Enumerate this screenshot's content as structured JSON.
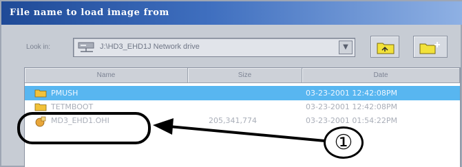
{
  "window": {
    "title": "File name to load image from"
  },
  "lookin": {
    "label": "Look in:",
    "path": "J:\\HD3_EHD1J Network drive"
  },
  "toolbar": {
    "up_icon": "folder-up-icon",
    "new_folder_icon": "new-folder-icon"
  },
  "list": {
    "columns": [
      "Name",
      "Size",
      "Date"
    ],
    "rows": [
      {
        "name": "PMUSH",
        "size": "",
        "date": "03-23-2001 12:42:08PM",
        "type": "folder",
        "selected": true
      },
      {
        "name": "TETMBOOT",
        "size": "",
        "date": "03-23-2001 12:42:08PM",
        "type": "folder",
        "selected": false
      },
      {
        "name": "MD3_EHD1.OHI",
        "size": "205,341,774",
        "date": "03-23-2001 01:54:22PM",
        "type": "image-file",
        "selected": false
      }
    ]
  },
  "callout": {
    "number": "①"
  },
  "colors": {
    "title_start": "#1f4a97",
    "title_end": "#8fb1e4",
    "selection": "#58b6f0",
    "folder": "#f2c23a"
  }
}
